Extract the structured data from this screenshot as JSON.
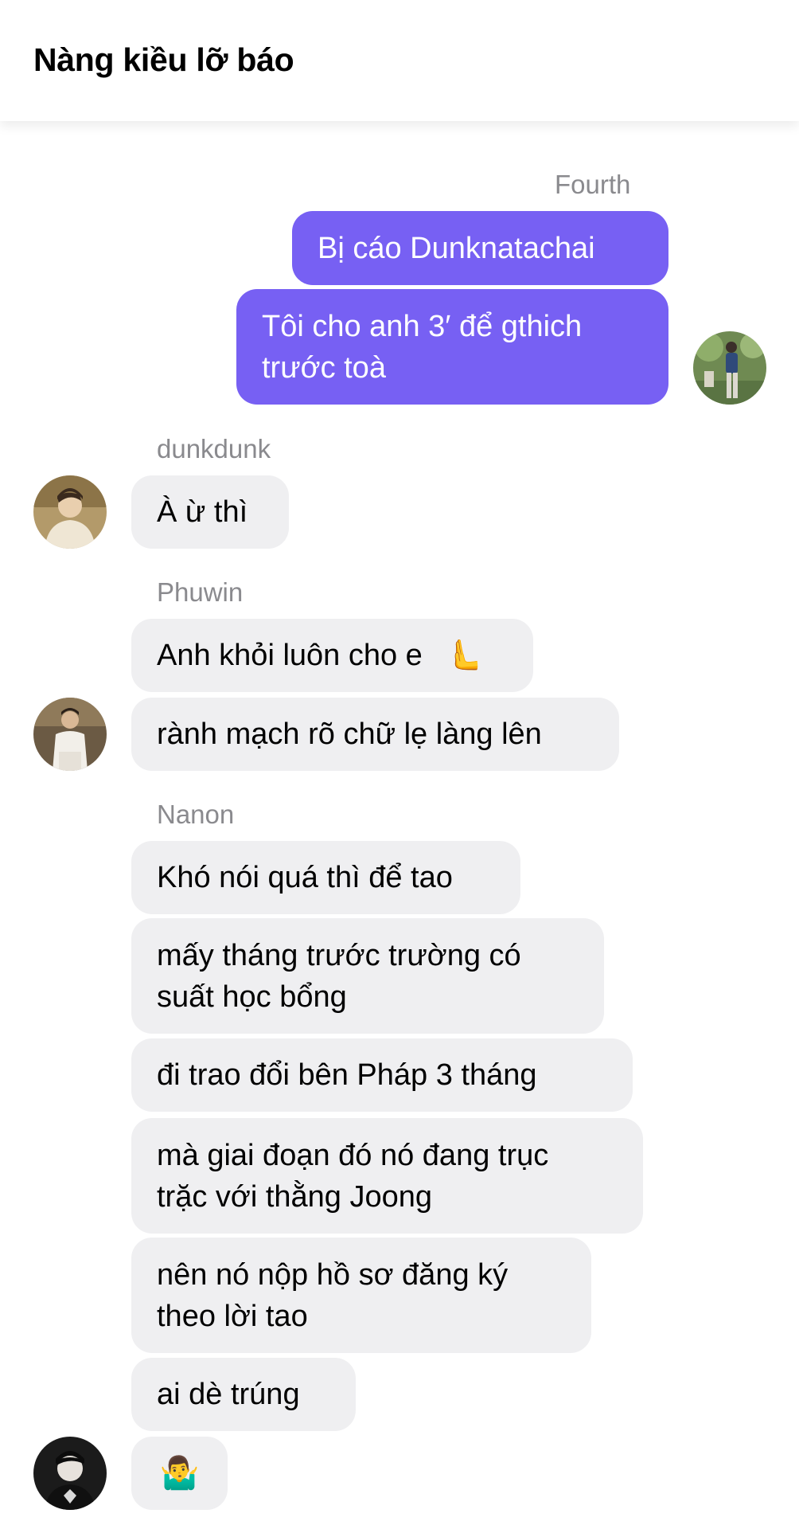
{
  "header": {
    "title": "Nàng kiều lỡ báo"
  },
  "messages": {
    "fourth": {
      "sender": "Fourth",
      "m1": "Bị cáo Dunknatachai",
      "m2_line1": "Tôi cho anh 3′ để gthich",
      "m2_line2": "trước toà"
    },
    "dunk": {
      "sender": "dunkdunk",
      "m1": "À ừ thì"
    },
    "phuwin": {
      "sender": "Phuwin",
      "m1": "Anh khỏi luôn cho e",
      "m1_emoji": "🫷",
      "m2": "rành mạch rõ chữ lẹ làng lên"
    },
    "nanon": {
      "sender": "Nanon",
      "m1": "Khó nói quá thì để tao",
      "m2_line1": "mấy tháng trước trường có",
      "m2_line2": "suất học bổng",
      "m3": "đi trao đổi bên Pháp 3 tháng",
      "m4_line1": "mà giai đoạn đó nó đang trục",
      "m4_line2": "trặc với thằng Joong",
      "m5_line1": "nên nó nộp hồ sơ đăng ký",
      "m5_line2": "theo lời tao",
      "m6": "ai dè trúng",
      "m7_emoji": "🤷‍♂️"
    }
  },
  "colors": {
    "outgoing_bubble": "#7760f3",
    "incoming_bubble": "#efeff1",
    "sender_name": "#8a8a8e"
  }
}
